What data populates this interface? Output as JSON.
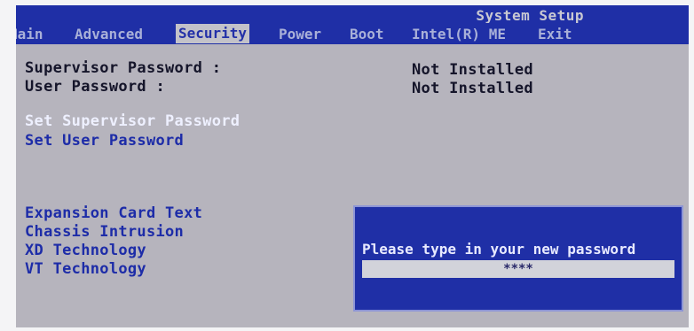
{
  "window": {
    "title": "System Setup"
  },
  "menu": {
    "items": [
      {
        "label": "Main"
      },
      {
        "label": "Advanced"
      },
      {
        "label": "Security"
      },
      {
        "label": "Power"
      },
      {
        "label": "Boot"
      },
      {
        "label": "Intel(R) ME"
      },
      {
        "label": "Exit"
      }
    ],
    "active": "Security"
  },
  "security": {
    "supervisor_password_label": "Supervisor Password :",
    "supervisor_password_status": "Not Installed",
    "user_password_label": "User Password :",
    "user_password_status": "Not Installed",
    "set_supervisor_password": "Set Supervisor Password",
    "set_user_password": "Set User Password",
    "expansion_card_text": "Expansion Card Text",
    "chassis_intrusion": "Chassis Intrusion",
    "xd_technology": "XD Technology",
    "vt_technology": "VT Technology"
  },
  "dialog": {
    "prompt": "Please type in your new password",
    "password_value": "****"
  },
  "colors": {
    "bar_blue": "#1f2fa6",
    "screen_gray": "#b6b4bd",
    "active_tab": "#c3c2c9"
  }
}
